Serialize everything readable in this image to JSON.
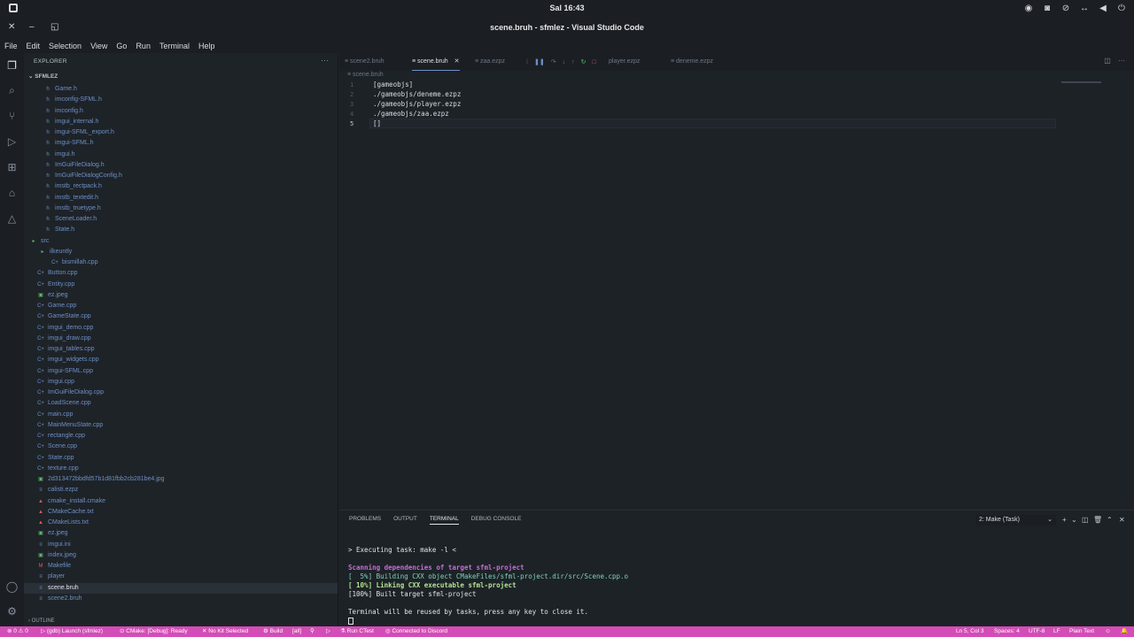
{
  "topbar": {
    "clock": "Sal 16:43",
    "tray_icons": [
      "appindicator-icon",
      "discord-icon",
      "notifications-off-icon",
      "network-icon",
      "volume-icon",
      "power-icon"
    ]
  },
  "window": {
    "title": "scene.bruh - sfmlez - Visual Studio Code"
  },
  "menu": [
    "File",
    "Edit",
    "Selection",
    "View",
    "Go",
    "Run",
    "Terminal",
    "Help"
  ],
  "sidebar": {
    "header": "EXPLORER",
    "project": "SFMLEZ",
    "items": [
      {
        "label": "Game.h",
        "icon": "h"
      },
      {
        "label": "imconfig-SFML.h",
        "icon": "h"
      },
      {
        "label": "imconfig.h",
        "icon": "h"
      },
      {
        "label": "imgui_internal.h",
        "icon": "h"
      },
      {
        "label": "imgui-SFML_export.h",
        "icon": "h"
      },
      {
        "label": "imgui-SFML.h",
        "icon": "h"
      },
      {
        "label": "imgui.h",
        "icon": "h"
      },
      {
        "label": "ImGuiFileDialog.h",
        "icon": "h"
      },
      {
        "label": "ImGuiFileDialogConfig.h",
        "icon": "h"
      },
      {
        "label": "imstb_rectpack.h",
        "icon": "h"
      },
      {
        "label": "imstb_textedit.h",
        "icon": "h"
      },
      {
        "label": "imstb_truetype.h",
        "icon": "h"
      },
      {
        "label": "SceneLoader.h",
        "icon": "h"
      },
      {
        "label": "State.h",
        "icon": "h"
      },
      {
        "label": "src",
        "icon": "folder"
      },
      {
        "label": "ilkeuntly",
        "icon": "folder"
      },
      {
        "label": "bismillah.cpp",
        "icon": "cpp"
      },
      {
        "label": "Button.cpp",
        "icon": "cpp"
      },
      {
        "label": "Entity.cpp",
        "icon": "cpp"
      },
      {
        "label": "ez.jpeg",
        "icon": "img"
      },
      {
        "label": "Game.cpp",
        "icon": "cpp"
      },
      {
        "label": "GameState.cpp",
        "icon": "cpp"
      },
      {
        "label": "imgui_demo.cpp",
        "icon": "cpp"
      },
      {
        "label": "imgui_draw.cpp",
        "icon": "cpp"
      },
      {
        "label": "imgui_tables.cpp",
        "icon": "cpp"
      },
      {
        "label": "imgui_widgets.cpp",
        "icon": "cpp"
      },
      {
        "label": "imgui-SFML.cpp",
        "icon": "cpp"
      },
      {
        "label": "imgui.cpp",
        "icon": "cpp"
      },
      {
        "label": "ImGuiFileDialog.cpp",
        "icon": "cpp"
      },
      {
        "label": "LoadScene.cpp",
        "icon": "cpp"
      },
      {
        "label": "main.cpp",
        "icon": "cpp"
      },
      {
        "label": "MainMenuState.cpp",
        "icon": "cpp"
      },
      {
        "label": "rectangle.cpp",
        "icon": "cpp"
      },
      {
        "label": "Scene.cpp",
        "icon": "cpp"
      },
      {
        "label": "State.cpp",
        "icon": "cpp"
      },
      {
        "label": "texture.cpp",
        "icon": "cpp"
      },
      {
        "label": "2d313472bbdfd57b1d81fbb2cb281be4.jpg",
        "icon": "img"
      },
      {
        "label": "calisti.ezpz",
        "icon": "file"
      },
      {
        "label": "cmake_install.cmake",
        "icon": "cmake"
      },
      {
        "label": "CMakeCache.txt",
        "icon": "cmake"
      },
      {
        "label": "CMakeLists.txt",
        "icon": "cmake"
      },
      {
        "label": "ez.jpeg",
        "icon": "img"
      },
      {
        "label": "imgui.ini",
        "icon": "file"
      },
      {
        "label": "index.jpeg",
        "icon": "img"
      },
      {
        "label": "Makefile",
        "icon": "make"
      },
      {
        "label": "player",
        "icon": "file"
      },
      {
        "label": "scene.bruh",
        "icon": "file"
      },
      {
        "label": "scene2.bruh",
        "icon": "file"
      }
    ],
    "outline": "OUTLINE"
  },
  "editor": {
    "tabs": [
      {
        "label": "scene2.bruh"
      },
      {
        "label": "scene.bruh"
      },
      {
        "label": "zaa.ezpz"
      },
      {
        "label": "player.ezpz"
      },
      {
        "label": "deneme.ezpz"
      }
    ],
    "breadcrumb": "scene.bruh",
    "lines": [
      {
        "n": "1",
        "text": "[gameobjs]"
      },
      {
        "n": "2",
        "text": "./gameobjs/deneme.ezpz"
      },
      {
        "n": "3",
        "text": "./gameobjs/player.ezpz"
      },
      {
        "n": "4",
        "text": "./gameobjs/zaa.ezpz"
      },
      {
        "n": "5",
        "text": "[]"
      }
    ]
  },
  "panel": {
    "tabs": [
      "PROBLEMS",
      "OUTPUT",
      "TERMINAL",
      "DEBUG CONSOLE"
    ],
    "task": "2: Make (Task)",
    "terminal": [
      "> Executing task: make -l <",
      "Scanning dependencies of target sfml-project",
      "[  5%] Building CXX object CMakeFiles/sfml-project.dir/src/Scene.cpp.o",
      "[ 10%] Linking CXX executable sfml-project",
      "[100%] Built target sfml-project",
      "Terminal will be reused by tasks, press any key to close it."
    ]
  },
  "status": {
    "errors": "⊗ 0 ⚠ 0",
    "launch": "(gdb) Launch (sfmlez)",
    "cmake": "CMake: [Debug]: Ready",
    "kit": "No Kit Selected",
    "build": "Build",
    "all": "[all]",
    "ctest": "Run CTest",
    "discord": "Connected to Discord",
    "position": "Ln 5, Col 3",
    "spaces": "Spaces: 4",
    "encoding": "UTF-8",
    "eol": "LF",
    "language": "Plain Text",
    "color": "#d44cb7"
  }
}
